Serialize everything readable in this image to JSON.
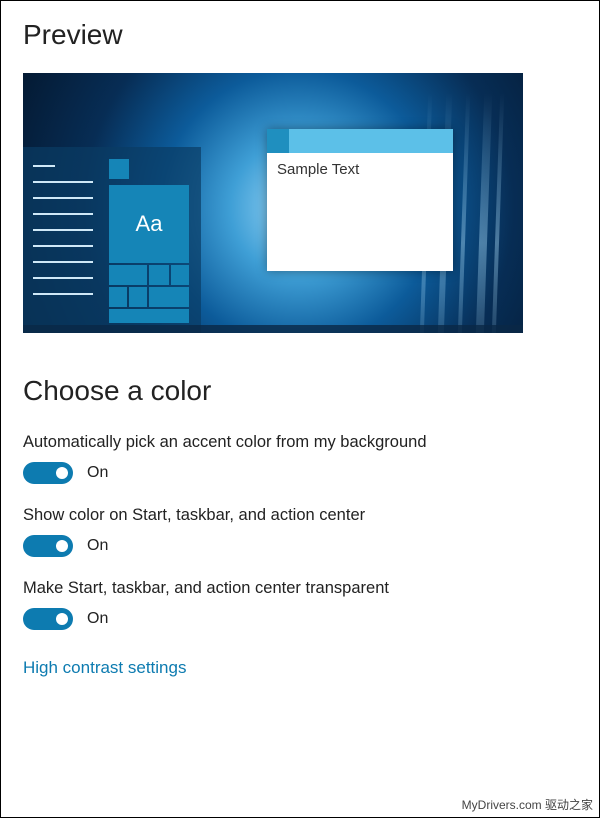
{
  "headings": {
    "preview": "Preview",
    "choose_color": "Choose a color"
  },
  "preview": {
    "sample_text": "Sample Text",
    "font_sample": "Aa"
  },
  "settings": {
    "auto_accent": {
      "label": "Automatically pick an accent color from my background",
      "state": "On",
      "on": true
    },
    "show_color": {
      "label": "Show color on Start, taskbar, and action center",
      "state": "On",
      "on": true
    },
    "transparent": {
      "label": "Make Start, taskbar, and action center transparent",
      "state": "On",
      "on": true
    }
  },
  "links": {
    "high_contrast": "High contrast settings"
  },
  "colors": {
    "accent": "#0d7bb0"
  },
  "watermark": "MyDrivers.com 驱动之家"
}
